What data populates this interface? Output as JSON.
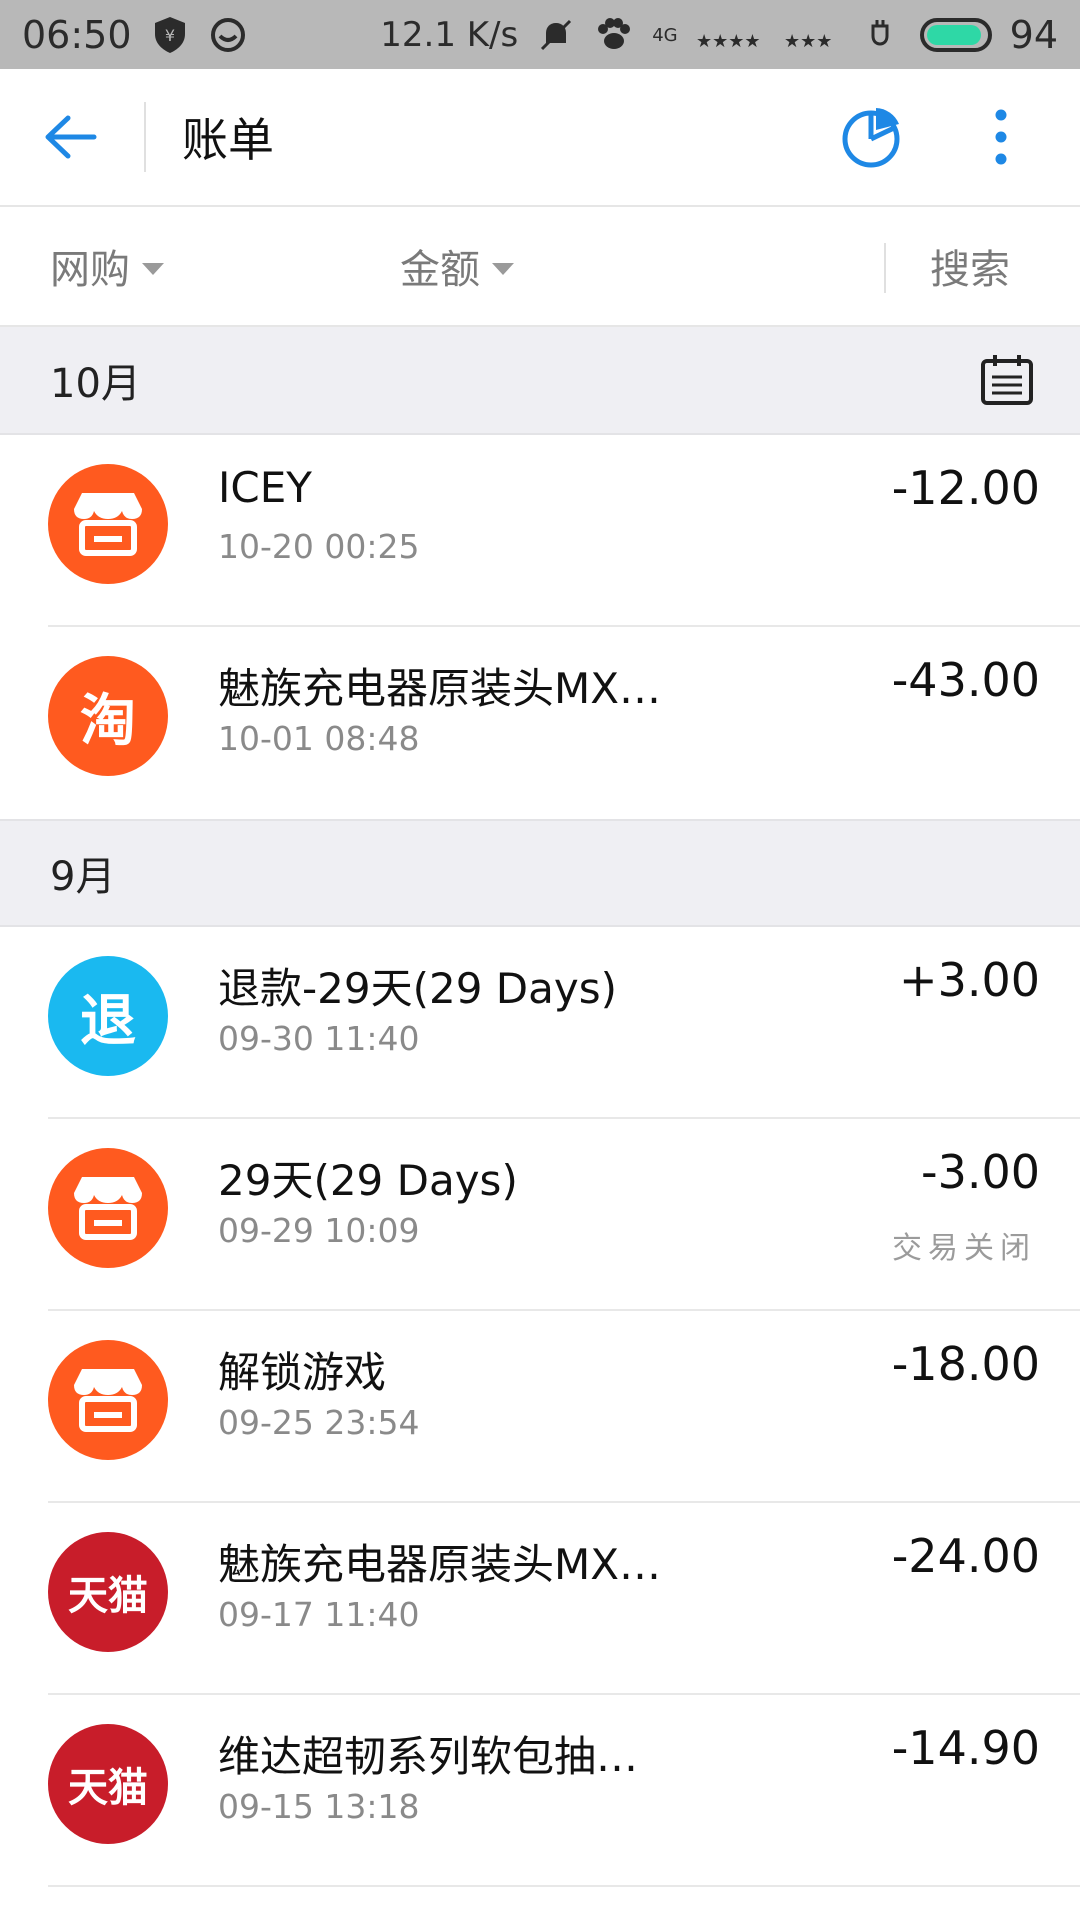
{
  "statusbar": {
    "time": "06:50",
    "speed": "12.1 K/s",
    "network": "4G",
    "battery": "94",
    "battery_color": "#2ed8a6"
  },
  "header": {
    "title": "账单",
    "accent": "#1e88e5"
  },
  "filters": {
    "category": "网购",
    "amount": "金额",
    "search": "搜索"
  },
  "months": [
    {
      "label": "10月"
    },
    {
      "label": "9月"
    }
  ],
  "transactions": [
    {
      "icon": "shop-icon",
      "color": "#ff5a1f",
      "name": "ICEY",
      "time": "10-20 00:25",
      "amount": "-12.00"
    },
    {
      "icon": "taobao-icon",
      "color": "#ff5a1f",
      "avatar_text": "淘",
      "name": "魅族充电器原装头MX…",
      "time": "10-01 08:48",
      "amount": "-43.00"
    },
    {
      "icon": "refund-icon",
      "color": "#1ab9f0",
      "avatar_text": "退",
      "name": "退款-29天(29 Days)",
      "time": "09-30 11:40",
      "amount": "+3.00"
    },
    {
      "icon": "shop-icon",
      "color": "#ff5a1f",
      "name": "29天(29 Days)",
      "time": "09-29 10:09",
      "amount": "-3.00",
      "note": "交易关闭"
    },
    {
      "icon": "shop-icon",
      "color": "#ff5a1f",
      "name": "解锁游戏",
      "time": "09-25 23:54",
      "amount": "-18.00"
    },
    {
      "icon": "tmall-icon",
      "color": "#c81d2a",
      "avatar_text": "天猫",
      "name": "魅族充电器原装头MX…",
      "time": "09-17 11:40",
      "amount": "-24.00"
    },
    {
      "icon": "tmall-icon",
      "color": "#c81d2a",
      "avatar_text": "天猫",
      "name": "维达超韧系列软包抽…",
      "time": "09-15 13:18",
      "amount": "-14.90"
    }
  ]
}
